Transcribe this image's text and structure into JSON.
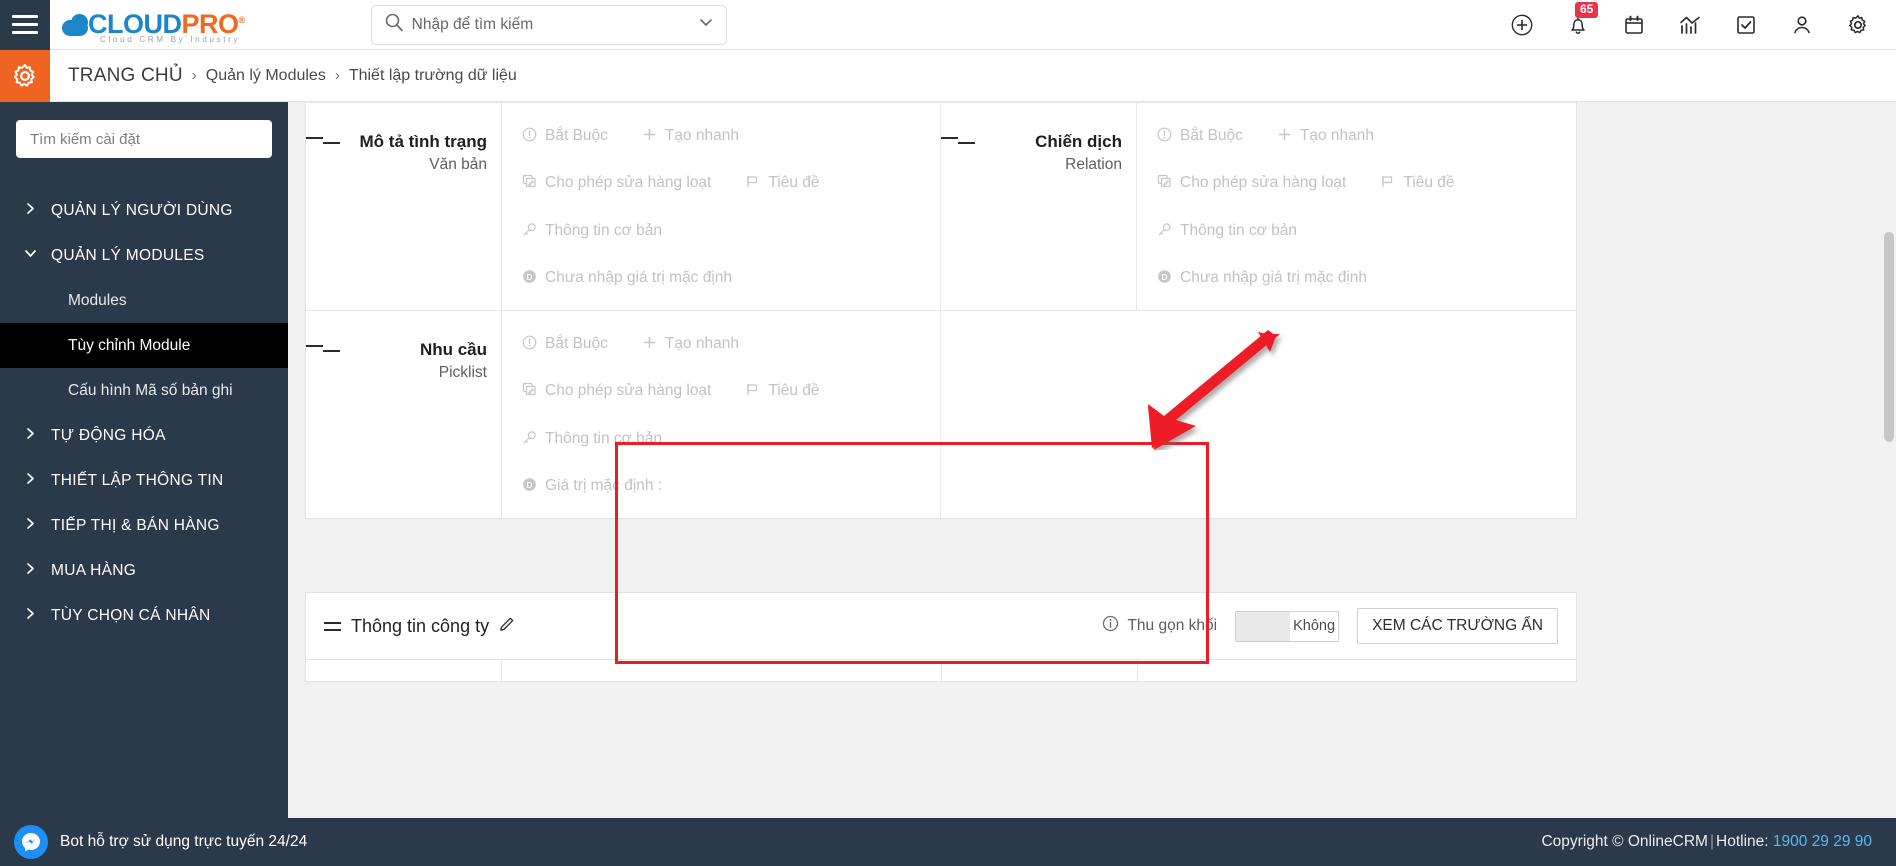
{
  "header": {
    "menu_icon": "hamburger-icon",
    "logo": {
      "part1": "CLOUD",
      "part2": "PRO",
      "registered": "®",
      "tagline": "Cloud CRM By Industry"
    },
    "search": {
      "placeholder": "Nhập để tìm kiếm",
      "value": "",
      "icon": "search-icon",
      "dropdown_icon": "chevron-down-icon"
    },
    "icons": [
      {
        "name": "add-circle-icon",
        "label": "Thêm mới"
      },
      {
        "name": "bell-icon",
        "label": "Thông báo",
        "badge": "65"
      },
      {
        "name": "calendar-icon",
        "label": "Lịch"
      },
      {
        "name": "analytics-icon",
        "label": "Báo cáo"
      },
      {
        "name": "task-check-icon",
        "label": "Công việc"
      },
      {
        "name": "user-icon",
        "label": "Tài khoản"
      },
      {
        "name": "gear-icon",
        "label": "Cài đặt"
      }
    ]
  },
  "breadcrumb": {
    "gear_icon": "settings-gear-icon",
    "home": "TRANG CHỦ",
    "separator": "›",
    "items": [
      "Quản lý Modules",
      "Thiết lập trường dữ liệu"
    ]
  },
  "sidebar": {
    "search_placeholder": "Tìm kiếm cài đặt",
    "search_value": "",
    "items": [
      {
        "label": "QUẢN LÝ NGƯỜI DÙNG",
        "type": "group",
        "expanded": false,
        "icon": "chevron-right-icon"
      },
      {
        "label": "QUẢN LÝ MODULES",
        "type": "group",
        "expanded": true,
        "icon": "chevron-down-icon"
      },
      {
        "label": "Modules",
        "type": "sub",
        "active": false
      },
      {
        "label": "Tùy chỉnh Module",
        "type": "sub",
        "active": true
      },
      {
        "label": "Cấu hình Mã số bản ghi",
        "type": "sub",
        "active": false
      },
      {
        "label": "TỰ ĐỘNG HÓA",
        "type": "group",
        "expanded": false,
        "icon": "chevron-right-icon"
      },
      {
        "label": "THIẾT LẬP THÔNG TIN",
        "type": "group",
        "expanded": false,
        "icon": "chevron-right-icon"
      },
      {
        "label": "TIẾP THỊ & BÁN HÀNG",
        "type": "group",
        "expanded": false,
        "icon": "chevron-right-icon"
      },
      {
        "label": "MUA HÀNG",
        "type": "group",
        "expanded": false,
        "icon": "chevron-right-icon"
      },
      {
        "label": "TÙY CHỌN CÁ NHÂN",
        "type": "group",
        "expanded": false,
        "icon": "chevron-right-icon"
      }
    ]
  },
  "main": {
    "field_cards": [
      {
        "name": "Mô tả tình trạng",
        "type": "Văn bản",
        "drag_icon": "drag-handle-icon",
        "options": {
          "required": {
            "label": "Bắt Buộc",
            "icon": "exclamation-circle-icon"
          },
          "quick_create": {
            "label": "Tạo nhanh",
            "icon": "plus-icon"
          },
          "mass_edit": {
            "label": "Cho phép sửa hàng loạt",
            "icon": "mass-edit-icon"
          },
          "title": {
            "label": "Tiêu đề",
            "icon": "flag-icon"
          },
          "basic_info": {
            "label": "Thông tin cơ bản",
            "icon": "key-icon"
          },
          "default_value": {
            "label": "Chưa nhập giá trị mặc định",
            "icon": "default-value-icon"
          }
        },
        "highlighted": false
      },
      {
        "name": "Chiến dịch",
        "type": "Relation",
        "drag_icon": "drag-handle-icon",
        "options": {
          "required": {
            "label": "Bắt Buộc",
            "icon": "exclamation-circle-icon"
          },
          "quick_create": {
            "label": "Tạo nhanh",
            "icon": "plus-icon"
          },
          "mass_edit": {
            "label": "Cho phép sửa hàng loạt",
            "icon": "mass-edit-icon"
          },
          "title": {
            "label": "Tiêu đề",
            "icon": "flag-icon"
          },
          "basic_info": {
            "label": "Thông tin cơ bản",
            "icon": "key-icon"
          },
          "default_value": {
            "label": "Chưa nhập giá trị mặc định",
            "icon": "default-value-icon"
          }
        },
        "highlighted": false
      },
      {
        "name": "Nhu cầu",
        "type": "Picklist",
        "drag_icon": "drag-handle-icon",
        "options": {
          "required": {
            "label": "Bắt Buộc",
            "icon": "exclamation-circle-icon"
          },
          "quick_create": {
            "label": "Tạo nhanh",
            "icon": "plus-icon"
          },
          "mass_edit": {
            "label": "Cho phép sửa hàng loạt",
            "icon": "mass-edit-icon"
          },
          "title": {
            "label": "Tiêu đề",
            "icon": "flag-icon"
          },
          "basic_info": {
            "label": "Thông tin cơ bản",
            "icon": "key-icon"
          },
          "default_value": {
            "label": "Giá trị mặc định :",
            "icon": "default-value-icon"
          }
        },
        "highlighted": true
      }
    ],
    "block": {
      "title": "Thông tin công ty",
      "edit_icon": "pencil-icon",
      "collapse_label": "Thu gọn khối",
      "collapse_info_icon": "info-circle-icon",
      "toggle_value": "Không",
      "hidden_fields_button": "XEM CÁC TRƯỜNG ẨN"
    },
    "annotation": {
      "shape": "red-arrow",
      "color": "#ec1c24"
    },
    "highlight_color": "#ec1c24"
  },
  "footer": {
    "chat_icon": "messenger-icon",
    "chat_text": "Bot hỗ trợ sử dụng trực tuyến 24/24",
    "copyright": "Copyright © OnlineCRM",
    "separator": "|",
    "hotline_label": "Hotline:",
    "hotline_number": "1900 29 29 90"
  },
  "theme": {
    "sidebar_bg": "#2b3a4b",
    "accent_orange": "#f06423",
    "logo_blue": "#1b87c9",
    "badge_red": "#e8334a",
    "link_blue": "#56b9f0"
  }
}
